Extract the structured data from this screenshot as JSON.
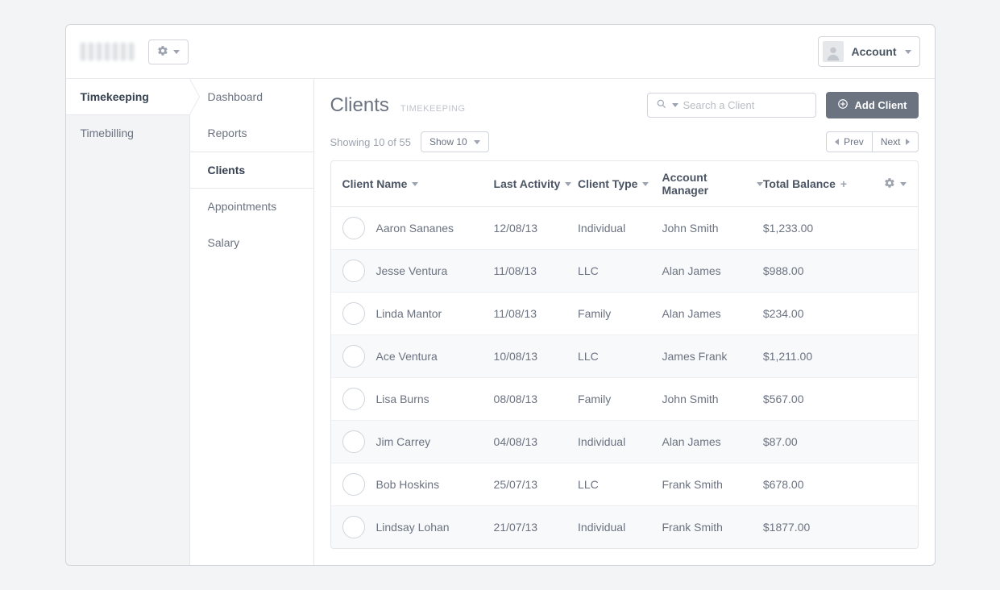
{
  "topbar": {
    "account_label": "Account"
  },
  "sidebar_primary": {
    "items": [
      {
        "label": "Timekeeping",
        "active": true
      },
      {
        "label": "Timebilling",
        "active": false
      }
    ]
  },
  "sidebar_secondary": {
    "items": [
      {
        "label": "Dashboard",
        "active": false
      },
      {
        "label": "Reports",
        "active": false
      },
      {
        "label": "Clients",
        "active": true
      },
      {
        "label": "Appointments",
        "active": false
      },
      {
        "label": "Salary",
        "active": false
      }
    ]
  },
  "main": {
    "title": "Clients",
    "subtitle": "TIMEKEEPING",
    "search_placeholder": "Search a Client",
    "add_button": "Add Client",
    "showing_text": "Showing 10 of 55",
    "show_selector": "Show 10",
    "prev_label": "Prev",
    "next_label": "Next"
  },
  "table": {
    "columns": {
      "name": "Client Name",
      "last_activity": "Last Activity",
      "type": "Client Type",
      "manager": "Account Manager",
      "balance": "Total Balance"
    },
    "rows": [
      {
        "name": "Aaron Sananes",
        "last_activity": "12/08/13",
        "type": "Individual",
        "manager": "John Smith",
        "balance": "$1,233.00"
      },
      {
        "name": "Jesse Ventura",
        "last_activity": "11/08/13",
        "type": "LLC",
        "manager": "Alan James",
        "balance": "$988.00"
      },
      {
        "name": "Linda Mantor",
        "last_activity": "11/08/13",
        "type": "Family",
        "manager": "Alan James",
        "balance": "$234.00"
      },
      {
        "name": "Ace Ventura",
        "last_activity": "10/08/13",
        "type": "LLC",
        "manager": "James Frank",
        "balance": "$1,211.00"
      },
      {
        "name": "Lisa Burns",
        "last_activity": "08/08/13",
        "type": "Family",
        "manager": "John Smith",
        "balance": "$567.00"
      },
      {
        "name": "Jim Carrey",
        "last_activity": "04/08/13",
        "type": "Individual",
        "manager": "Alan James",
        "balance": "$87.00"
      },
      {
        "name": "Bob Hoskins",
        "last_activity": "25/07/13",
        "type": "LLC",
        "manager": "Frank Smith",
        "balance": "$678.00"
      },
      {
        "name": "Lindsay Lohan",
        "last_activity": "21/07/13",
        "type": "Individual",
        "manager": "Frank Smith",
        "balance": "$1877.00"
      }
    ]
  }
}
